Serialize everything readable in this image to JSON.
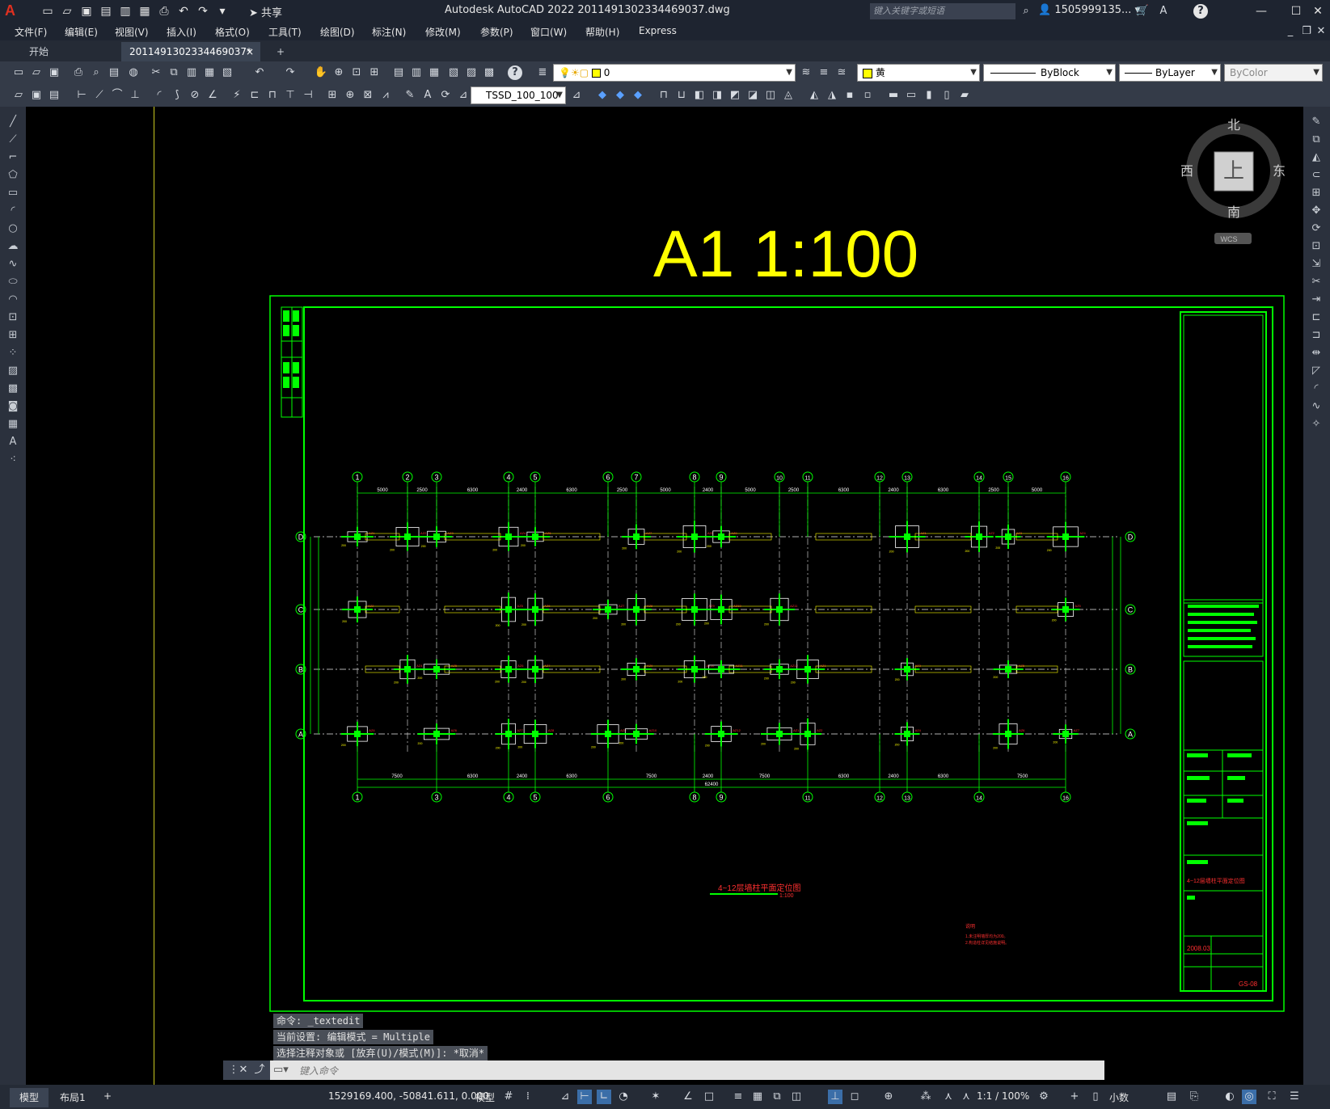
{
  "titlebar": {
    "app_icon": "A",
    "share_label": "共享",
    "title": "Autodesk AutoCAD 2022    2011491302334469037.dwg",
    "search_placeholder": "键入关键字或短语",
    "user": "1505999135...",
    "help": "?"
  },
  "menu": [
    "文件(F)",
    "编辑(E)",
    "视图(V)",
    "插入(I)",
    "格式(O)",
    "工具(T)",
    "绘图(D)",
    "标注(N)",
    "修改(M)",
    "参数(P)",
    "窗口(W)",
    "帮助(H)",
    "Express"
  ],
  "tabs": {
    "start": "开始",
    "doc": "2011491302334469037*",
    "close": "×",
    "add": "+"
  },
  "toolbar": {
    "layer_value": "0",
    "color_value": "黄",
    "linetype_value": "ByBlock",
    "lineweight_value": "ByLayer",
    "plotstyle_value": "ByColor",
    "dimstyle_value": "TSSD_100_100"
  },
  "viewcube": {
    "north": "北",
    "south": "南",
    "east": "东",
    "west": "西",
    "face": "上",
    "wcs": "WCS"
  },
  "drawing": {
    "scale_title": "A1  1:100",
    "plan_title": "4~12层墙柱平面定位图",
    "plan_scale": "1:100",
    "notes_title": "说明",
    "notes_lines": [
      "1.未注明墙厚均为200。",
      "2.构造柱详见结施说明。"
    ],
    "sheet_name": "4~12层墙柱平面定位图",
    "date": "2008.03",
    "sheet_no": "GS-08",
    "top_axes": [
      "1",
      "2",
      "3",
      "4",
      "5",
      "6",
      "7",
      "8",
      "9",
      "10",
      "11",
      "12",
      "13",
      "14",
      "15",
      "16"
    ],
    "bottom_axes": [
      "1",
      "3",
      "4",
      "5",
      "6",
      "8",
      "9",
      "11",
      "12",
      "13",
      "14",
      "16"
    ],
    "row_axes": [
      "D",
      "C",
      "B",
      "A"
    ],
    "top_dims": [
      "5000",
      "2500",
      "6300",
      "2400",
      "6300",
      "2500",
      "5000",
      "2400",
      "5000",
      "2500",
      "6300",
      "2400",
      "6300",
      "2500",
      "5000"
    ],
    "bottom_dims": [
      "7500",
      "6300",
      "2400",
      "6300",
      "7500",
      "2400",
      "7500",
      "6300",
      "2400",
      "6300",
      "7500"
    ],
    "total_dim": "62400"
  },
  "command": {
    "history": [
      "命令: _textedit",
      "当前设置: 编辑模式 = Multiple",
      "选择注释对象或 [放弃(U)/模式(M)]: *取消*"
    ],
    "placeholder": "键入命令"
  },
  "layout_tabs": [
    "模型",
    "布局1",
    "+"
  ],
  "status": {
    "coords": "1529169.400, -50841.611, 0.000",
    "space": "模型",
    "scale": "1:1 / 100%",
    "units": "小数"
  },
  "colors": {
    "title_yellow": "#ffff00",
    "frame_green": "#00ff00",
    "text_red": "#ff3030"
  }
}
